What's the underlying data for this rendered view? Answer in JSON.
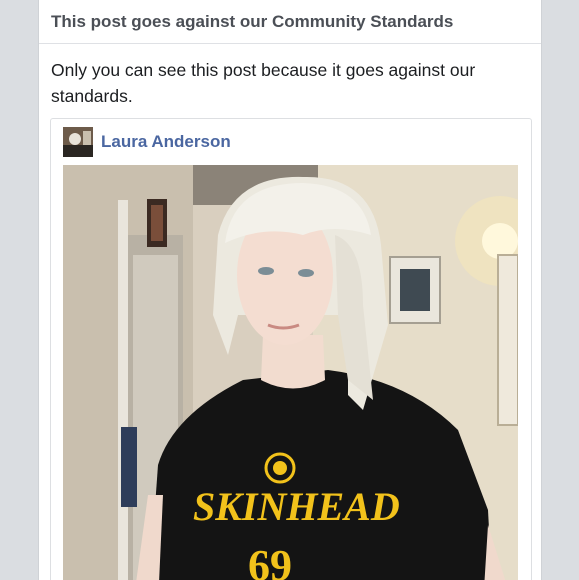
{
  "notice": {
    "title": "This post goes against our Community Standards",
    "message": "Only you can see this post because it goes against our standards."
  },
  "shared_post": {
    "author_name": "Laura Anderson",
    "avatar_icon": "profile-photo",
    "photo": {
      "shirt_text_line1": "SKINHEAD",
      "shirt_text_line2": "69"
    }
  },
  "colors": {
    "title_text": "#4b4f56",
    "author_link": "#4b67a1",
    "shirt_print": "#f2c21b"
  }
}
